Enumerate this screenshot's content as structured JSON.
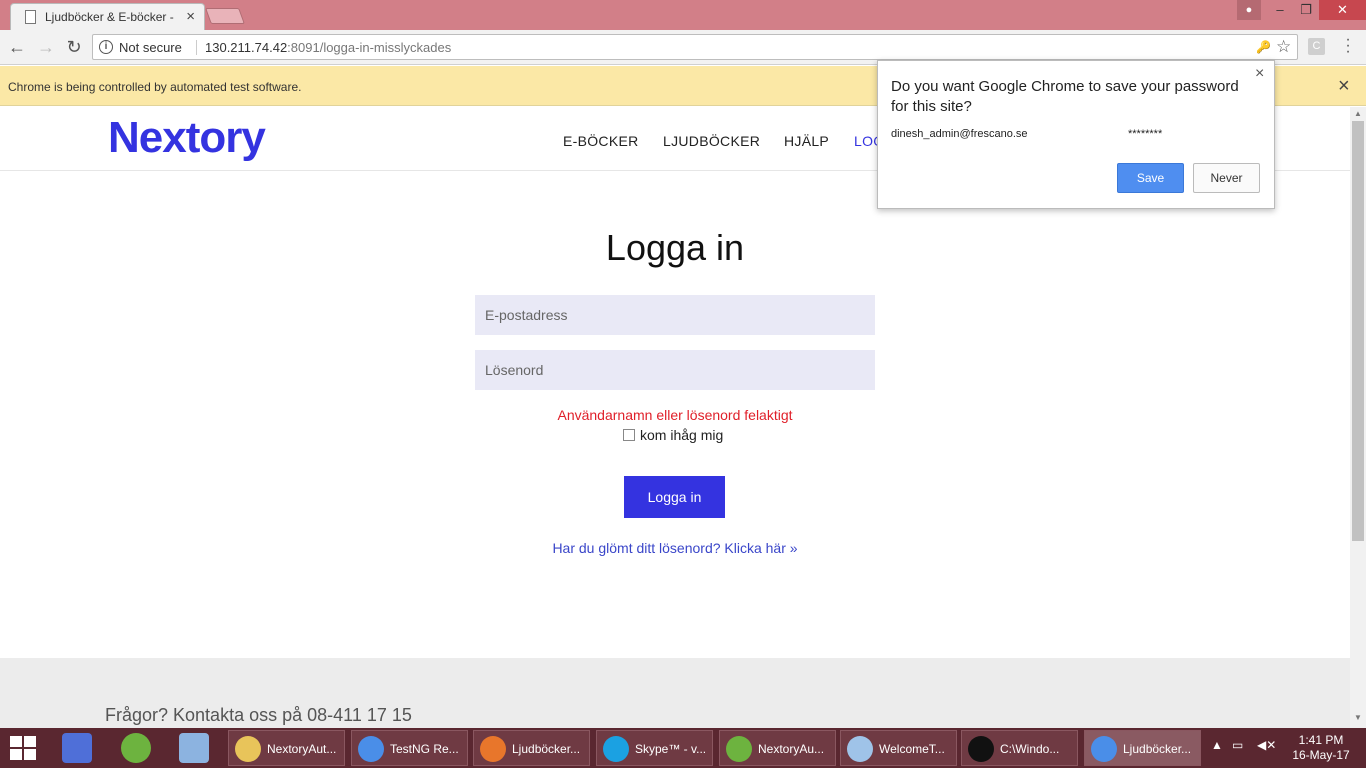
{
  "browser": {
    "tab_title": "Ljudböcker & E-böcker - ",
    "tab_close": "×",
    "security_label": "Not secure",
    "url_host": "130.211.74.42",
    "url_rest": ":8091/logga-in-misslyckades",
    "infobar_text": "Chrome is being controlled by automated test software.",
    "infobar_close": "×"
  },
  "site": {
    "logo": "Nextory",
    "nav": [
      "E-BÖCKER",
      "LJUDBÖCKER",
      "HJÄLP",
      "LOGGA IN"
    ],
    "login_title": "Logga in",
    "email_placeholder": "E-postadress",
    "password_placeholder": "Lösenord",
    "error": "Användarnamn eller lösenord felaktigt",
    "remember_label": "kom ihåg mig",
    "login_button": "Logga in",
    "forgot_link": "Har du glömt ditt lösenord? Klicka här »",
    "footer_text": "Frågor? Kontakta oss på 08-411 17 15"
  },
  "password_bubble": {
    "title": "Do you want Google Chrome to save your password for this site?",
    "username": "dinesh_admin@frescano.se",
    "password": "********",
    "save_label": "Save",
    "never_label": "Never",
    "close": "×"
  },
  "taskbar": {
    "tasks": [
      {
        "label": "NextoryAut...",
        "icon": "folder-icon",
        "color": "#e8c45a"
      },
      {
        "label": "TestNG Re...",
        "icon": "chrome-icon",
        "color": "#4a8ee8"
      },
      {
        "label": "Ljudböcker...",
        "icon": "firefox-icon",
        "color": "#e8762b"
      },
      {
        "label": "Skype™ - v...",
        "icon": "skype-icon",
        "color": "#1ba1e2"
      },
      {
        "label": "NextoryAu...",
        "icon": "spring-icon",
        "color": "#6db33f"
      },
      {
        "label": "WelcomeT...",
        "icon": "notepad-icon",
        "color": "#9fc3e8"
      },
      {
        "label": "C:\\Windo...",
        "icon": "cmd-icon",
        "color": "#111111"
      },
      {
        "label": "Ljudböcker...",
        "icon": "chrome-icon",
        "color": "#4a8ee8"
      }
    ],
    "time": "1:41 PM",
    "date": "16-May-17"
  },
  "colors": {
    "brand": "#3433e0",
    "error": "#e0202a",
    "title_bar": "#d27f88",
    "taskbar": "#5a2730"
  }
}
